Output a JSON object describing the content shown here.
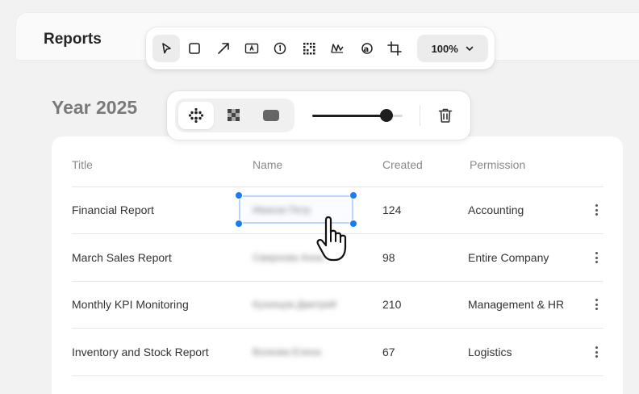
{
  "header": {
    "title": "Reports"
  },
  "toolbar": {
    "tools": [
      "pointer-icon",
      "rectangle-icon",
      "arrow-icon",
      "text-box-icon",
      "number-icon",
      "grid-blur-icon",
      "highlight-icon",
      "text-mark-icon",
      "crop-icon"
    ],
    "zoom_label": "100%"
  },
  "section": {
    "title": "Year 2025"
  },
  "blur_toolbar": {
    "modes": [
      "dots-blur-icon",
      "pixelate-icon",
      "solid-fill-icon"
    ],
    "active_mode": 0,
    "slider_value": 0.82
  },
  "table": {
    "headers": {
      "title": "Title",
      "name": "Name",
      "created": "Created",
      "permission": "Permission"
    },
    "rows": [
      {
        "title": "Financial Report",
        "name": "Иванов Петр",
        "created": "124",
        "permission": "Accounting"
      },
      {
        "title": "March Sales Report",
        "name": "Смирнова Анна",
        "created": "98",
        "permission": "Entire Company"
      },
      {
        "title": "Monthly KPI Monitoring",
        "name": "Кузнецов Дмитрий",
        "created": "210",
        "permission": "Management & HR"
      },
      {
        "title": "Inventory and Stock Report",
        "name": "Волкова Елена",
        "created": "67",
        "permission": "Logistics"
      }
    ]
  },
  "colors": {
    "accent": "#1a7cf5",
    "selection_border": "#b7d4fa"
  }
}
